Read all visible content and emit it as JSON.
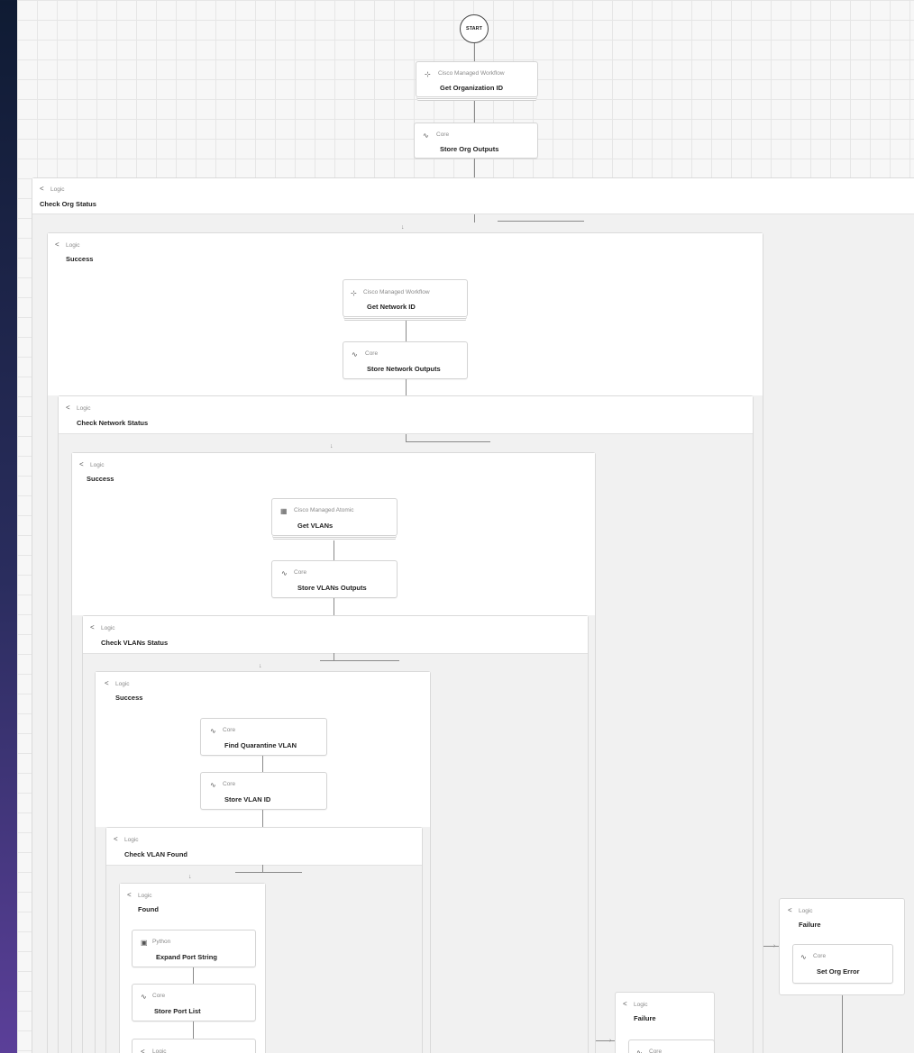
{
  "start": {
    "label": "START"
  },
  "icons": {
    "logic": "branch-icon",
    "core": "core-icon",
    "workflow": "workflow-icon",
    "atomic": "atomic-icon",
    "python": "python-icon"
  },
  "workflow": {
    "get_org": {
      "type": "Cisco Managed Workflow",
      "name": "Get Organization ID"
    },
    "store_org": {
      "type": "Core",
      "name": "Store Org Outputs"
    },
    "check_org": {
      "kind": "Logic",
      "title": "Check Org Status"
    },
    "org_success": {
      "kind": "Logic",
      "title": "Success"
    },
    "get_network": {
      "type": "Cisco Managed Workflow",
      "name": "Get Network ID"
    },
    "store_network": {
      "type": "Core",
      "name": "Store Network Outputs"
    },
    "check_network": {
      "kind": "Logic",
      "title": "Check Network Status"
    },
    "network_success": {
      "kind": "Logic",
      "title": "Success"
    },
    "get_vlans": {
      "type": "Cisco Managed Atomic",
      "name": "Get VLANs"
    },
    "store_vlans": {
      "type": "Core",
      "name": "Store VLANs Outputs"
    },
    "check_vlans": {
      "kind": "Logic",
      "title": "Check VLANs Status"
    },
    "vlans_success": {
      "kind": "Logic",
      "title": "Success"
    },
    "find_quarantine": {
      "type": "Core",
      "name": "Find Quarantine VLAN"
    },
    "store_vlan_id": {
      "type": "Core",
      "name": "Store VLAN ID"
    },
    "check_vlan_found": {
      "kind": "Logic",
      "title": "Check VLAN Found"
    },
    "found": {
      "kind": "Logic",
      "title": "Found"
    },
    "expand_port": {
      "type": "Python",
      "name": "Expand Port String"
    },
    "store_port_list": {
      "type": "Core",
      "name": "Store Port List"
    },
    "partial_logic": {
      "kind": "Logic"
    },
    "org_failure": {
      "kind": "Logic",
      "title": "Failure"
    },
    "set_org_error": {
      "type": "Core",
      "name": "Set Org Error"
    },
    "network_failure": {
      "kind": "Logic",
      "title": "Failure"
    },
    "partial_core": {
      "type": "Core"
    }
  }
}
